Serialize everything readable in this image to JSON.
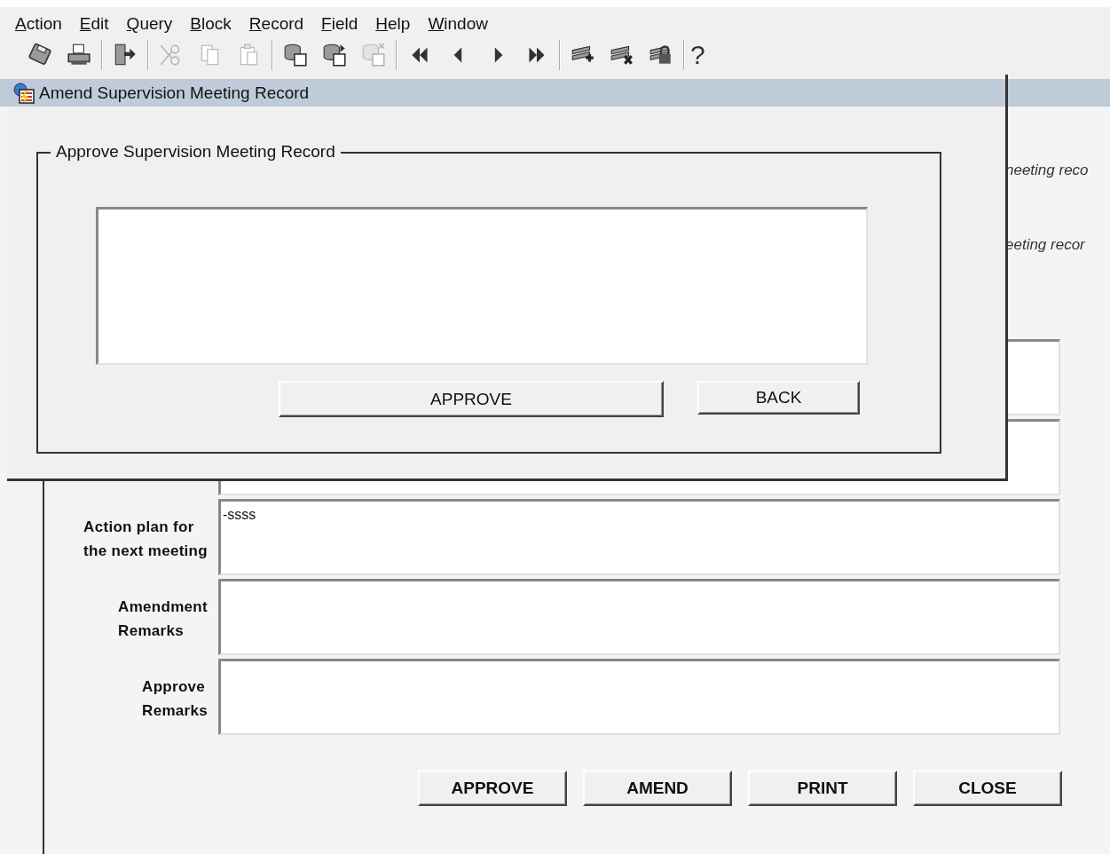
{
  "menu": [
    "Action",
    "Edit",
    "Query",
    "Block",
    "Record",
    "Field",
    "Help",
    "Window"
  ],
  "toolbar": [
    [
      {
        "disabled": false
      },
      {
        "disabled": false
      }
    ],
    [
      {
        "disabled": false
      }
    ],
    [
      {
        "disabled": true
      },
      {
        "disabled": true
      },
      {
        "disabled": true
      }
    ],
    [
      {
        "disabled": false
      },
      {
        "disabled": false
      },
      {
        "disabled": true
      }
    ],
    [
      {
        "disabled": false
      },
      {
        "disabled": false
      },
      {
        "disabled": false
      },
      {
        "disabled": false
      }
    ],
    [
      {
        "disabled": false
      },
      {
        "disabled": false
      },
      {
        "disabled": false
      }
    ]
  ],
  "help_button": {
    "label": "?"
  },
  "background_window": {
    "notes": [
      "neeting reco",
      "eeting recor"
    ],
    "fields": [
      {
        "kind": "textarea"
      },
      {
        "kind": "textarea"
      },
      {
        "kind": "textarea",
        "label": "Action plan for\nthe next meeting",
        "value": "-ssss"
      },
      {
        "kind": "textarea",
        "label": "Amendment\nRemarks"
      },
      {
        "kind": "textarea",
        "label": "Approve\nRemarks"
      }
    ],
    "buttons": [
      "APPROVE",
      "AMEND",
      "PRINT",
      "CLOSE"
    ]
  },
  "dialog": {
    "title": "Amend Supervision Meeting Record",
    "group_title": "Approve Supervision Meeting Record",
    "buttons": [
      "APPROVE",
      "BACK"
    ]
  }
}
